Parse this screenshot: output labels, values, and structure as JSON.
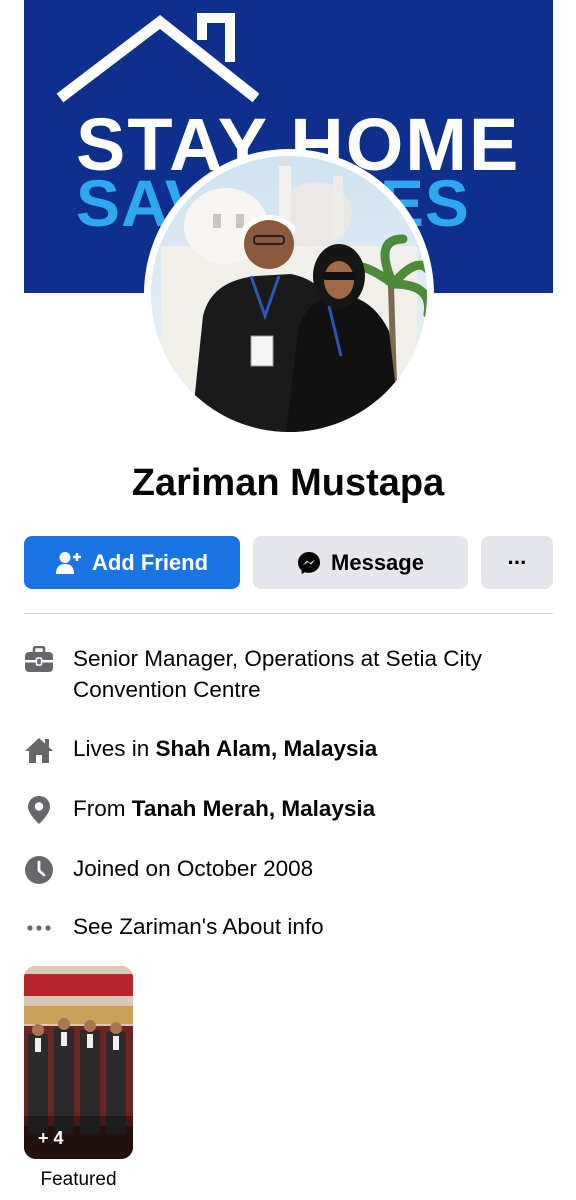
{
  "cover": {
    "line1": "STAY HOME",
    "line2": "SAVE LIVES",
    "background_color": "#0e2f8c",
    "line2_color": "#2ea8f0"
  },
  "profile": {
    "name": "Zariman Mustapa"
  },
  "actions": {
    "add_friend": "Add Friend",
    "message": "Message",
    "more": "···"
  },
  "info": {
    "work": "Senior Manager, Operations at Setia City Convention Centre",
    "lives_prefix": "Lives in ",
    "lives_place": "Shah Alam, Malaysia",
    "from_prefix": "From ",
    "from_place": "Tanah Merah, Malaysia",
    "joined": "Joined on October 2008",
    "about": "See Zariman's About info"
  },
  "featured": {
    "count": "+ 4",
    "label": "Featured"
  },
  "colors": {
    "accent": "#1b74e4",
    "secondary_button": "#e4e6eb",
    "icon_gray": "#65676b"
  },
  "icons": {
    "work": "briefcase-icon",
    "lives": "home-icon",
    "from": "location-pin-icon",
    "joined": "clock-icon",
    "about": "more-dots-icon",
    "add_friend": "person-add-icon",
    "message": "messenger-icon"
  }
}
